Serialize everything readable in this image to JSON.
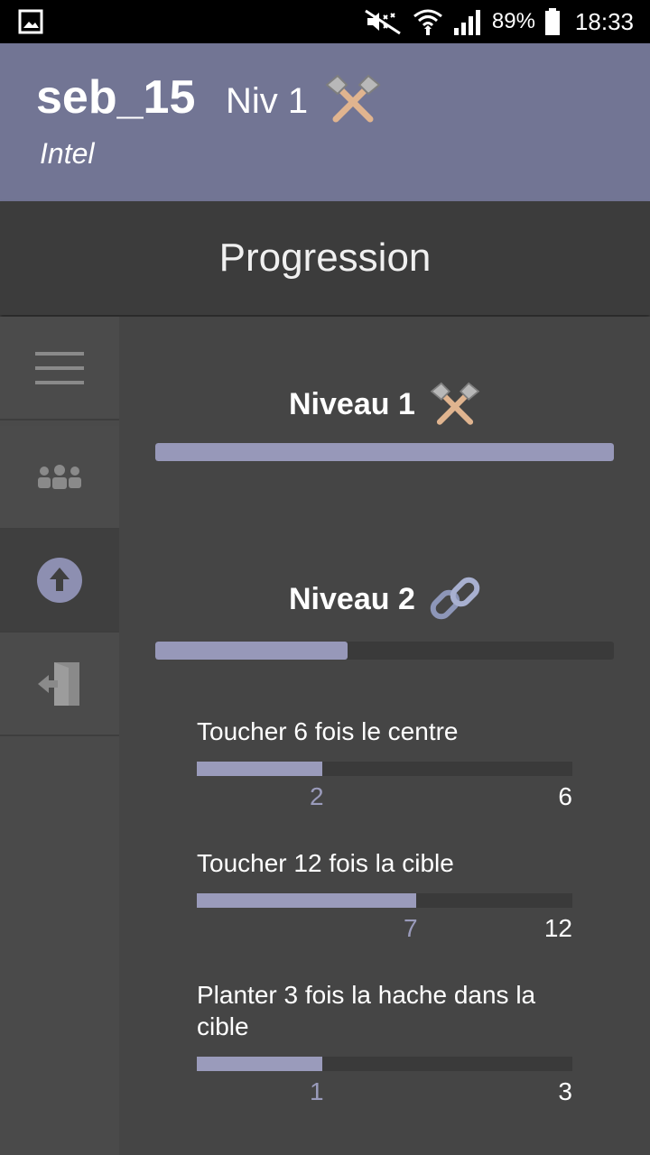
{
  "status_bar": {
    "battery_percent": "89%",
    "time": "18:33"
  },
  "header": {
    "username": "seb_15",
    "level_label": "Niv 1",
    "team": "Intel"
  },
  "page_title": "Progression",
  "sidebar": {
    "items": [
      {
        "icon": "menu-icon",
        "active": false
      },
      {
        "icon": "team-icon",
        "active": false
      },
      {
        "icon": "upgrade-arrow-icon",
        "active": true
      },
      {
        "icon": "logout-icon",
        "active": false
      }
    ]
  },
  "levels": [
    {
      "title": "Niveau 1",
      "icon": "crossed-axes-icon",
      "progress": 1.0
    },
    {
      "title": "Niveau 2",
      "icon": "chain-link-icon",
      "progress": 0.42
    }
  ],
  "tasks": [
    {
      "label": "Toucher 6 fois le centre",
      "current": "2",
      "max": "6",
      "progress": 0.3333
    },
    {
      "label": "Toucher 12 fois la cible",
      "current": "7",
      "max": "12",
      "progress": 0.5833
    },
    {
      "label": "Planter 3 fois la hache dans la cible",
      "current": "1",
      "max": "3",
      "progress": 0.3333
    }
  ],
  "colors": {
    "header_bg": "#727594",
    "accent": "#9798b9",
    "background": "#454545"
  }
}
